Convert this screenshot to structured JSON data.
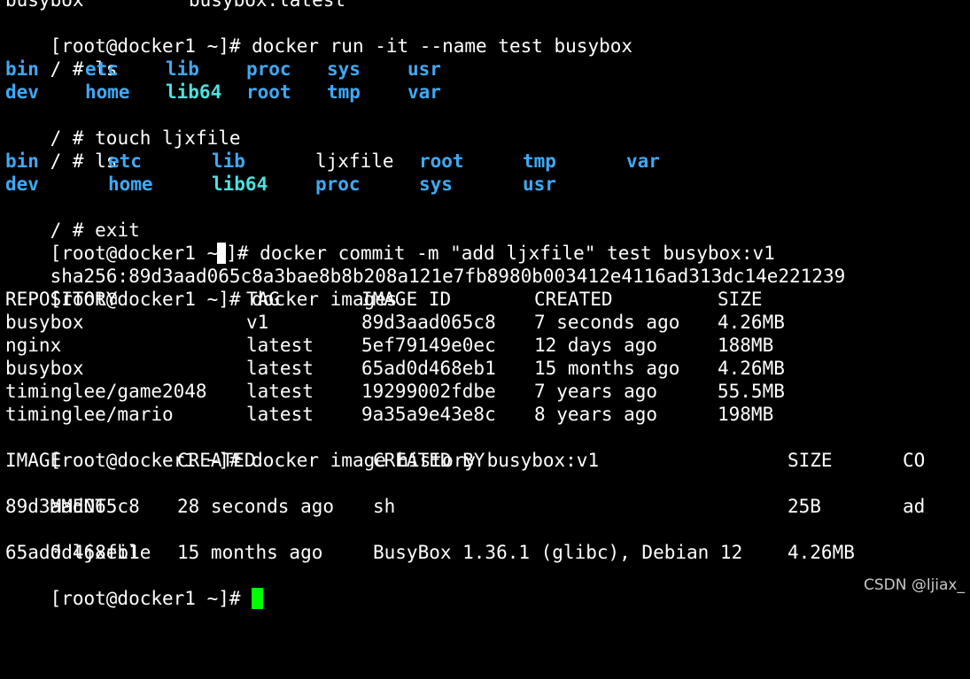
{
  "terminal": {
    "partial_top": {
      "repo": "busybox",
      "tag": "busybox:latest"
    },
    "l1": {
      "prompt": "[root@docker1 ~]# ",
      "cmd": "docker run -it --name test busybox"
    },
    "l2": {
      "prompt": "/ # ",
      "cmd": "ls"
    },
    "ls1": {
      "row1": [
        "bin",
        "etc",
        "lib",
        "proc",
        "sys",
        "usr"
      ],
      "row2": [
        "dev",
        "home",
        "lib64",
        "root",
        "tmp",
        "var"
      ]
    },
    "l3": {
      "prompt": "/ # ",
      "cmd": "touch ljxfile"
    },
    "l4": {
      "prompt": "/ # ",
      "cmd": "ls"
    },
    "ls2": {
      "row1": [
        "bin",
        "etc",
        "lib",
        "ljxfile",
        "root",
        "tmp",
        "var"
      ],
      "row2": [
        "dev",
        "home",
        "lib64",
        "proc",
        "sys",
        "usr"
      ]
    },
    "l5": {
      "prompt": "/ # ",
      "cmd": "exit"
    },
    "commit": {
      "prompt_a": "[root@docker1 ~",
      "prompt_b": "]# ",
      "cmd": "docker commit -m \"add ljxfile\" test busybox:v1"
    },
    "sha": "sha256:89d3aad065c8a3bae8b8b208a121e7fb8980b003412e4116ad313dc14e221239",
    "images_cmd": {
      "prompt": "[root@docker1 ~]# ",
      "cmd": "docker images"
    },
    "images_table": {
      "headers": [
        "REPOSITORY",
        "TAG",
        "IMAGE ID",
        "CREATED",
        "SIZE"
      ],
      "rows": [
        [
          "busybox",
          "v1",
          "89d3aad065c8",
          "7 seconds ago",
          "4.26MB"
        ],
        [
          "nginx",
          "latest",
          "5ef79149e0ec",
          "12 days ago",
          "188MB"
        ],
        [
          "busybox",
          "latest",
          "65ad0d468eb1",
          "15 months ago",
          "4.26MB"
        ],
        [
          "timinglee/game2048",
          "latest",
          "19299002fdbe",
          "7 years ago",
          "55.5MB"
        ],
        [
          "timinglee/mario",
          "latest",
          "9a35a9e43e8c",
          "8 years ago",
          "198MB"
        ]
      ]
    },
    "history_cmd": {
      "prompt": "[root@docker1 ~]# ",
      "cmd": "docker image history busybox:v1"
    },
    "history_table": {
      "headers": [
        "IMAGE",
        "CREATED",
        "CREATED BY",
        "SIZE",
        "CO"
      ],
      "header_wrap": "MMENT",
      "rows": [
        [
          "89d3aad065c8",
          "28 seconds ago",
          "sh",
          "25B",
          "ad"
        ],
        [
          "65ad0d468eb1",
          "15 months ago",
          "BusyBox 1.36.1 (glibc), Debian 12",
          "4.26MB",
          ""
        ]
      ],
      "row1_wrap": "d ljxfile"
    },
    "final_prompt": "[root@docker1 ~]# "
  },
  "watermark": "CSDN @ljiax_",
  "colors": {
    "background": "#000000",
    "text": "#ffffff",
    "dir": "#3fa9f5",
    "link": "#4de0e0",
    "cursor": "#00ff00"
  }
}
